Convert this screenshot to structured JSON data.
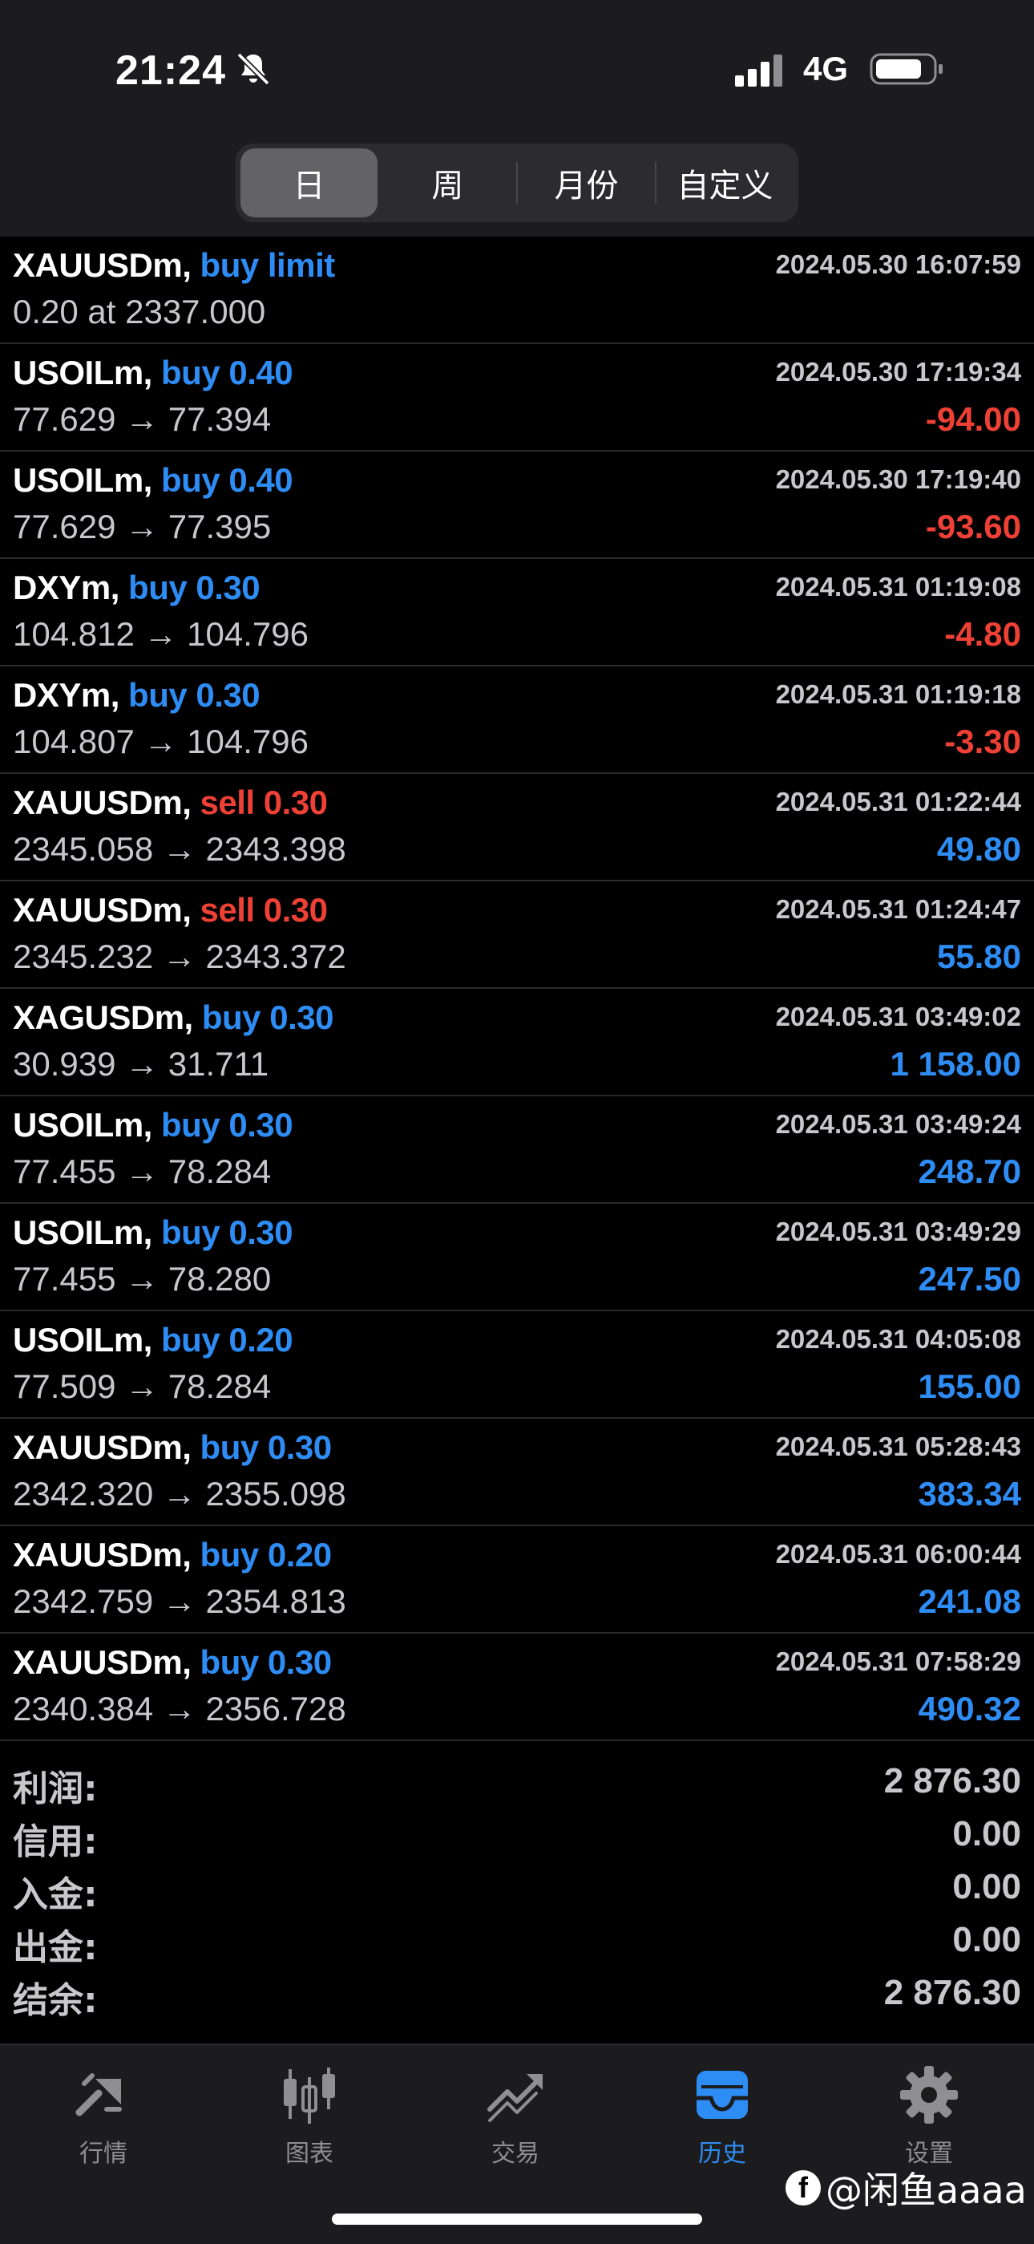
{
  "status_bar": {
    "time": "21:24",
    "network": "4G"
  },
  "period_tabs": [
    {
      "label": "日",
      "active": true
    },
    {
      "label": "周",
      "active": false
    },
    {
      "label": "月份",
      "active": false
    },
    {
      "label": "自定义",
      "active": false
    }
  ],
  "orders": [
    {
      "symbol": "XAUUSDm,",
      "side": "buy",
      "side_label": "buy limit",
      "date": "2024.05.30 16:07:59",
      "prices": "0.20 at 2337.000",
      "profit": "",
      "profit_type": "none"
    },
    {
      "symbol": "USOILm,",
      "side": "buy",
      "side_label": "buy 0.40",
      "date": "2024.05.30 17:19:34",
      "prices": "77.629 → 77.394",
      "profit": "-94.00",
      "profit_type": "neg"
    },
    {
      "symbol": "USOILm,",
      "side": "buy",
      "side_label": "buy 0.40",
      "date": "2024.05.30 17:19:40",
      "prices": "77.629 → 77.395",
      "profit": "-93.60",
      "profit_type": "neg"
    },
    {
      "symbol": "DXYm,",
      "side": "buy",
      "side_label": "buy 0.30",
      "date": "2024.05.31 01:19:08",
      "prices": "104.812 → 104.796",
      "profit": "-4.80",
      "profit_type": "neg"
    },
    {
      "symbol": "DXYm,",
      "side": "buy",
      "side_label": "buy 0.30",
      "date": "2024.05.31 01:19:18",
      "prices": "104.807 → 104.796",
      "profit": "-3.30",
      "profit_type": "neg"
    },
    {
      "symbol": "XAUUSDm,",
      "side": "sell",
      "side_label": "sell 0.30",
      "date": "2024.05.31 01:22:44",
      "prices": "2345.058 → 2343.398",
      "profit": "49.80",
      "profit_type": "pos"
    },
    {
      "symbol": "XAUUSDm,",
      "side": "sell",
      "side_label": "sell 0.30",
      "date": "2024.05.31 01:24:47",
      "prices": "2345.232 → 2343.372",
      "profit": "55.80",
      "profit_type": "pos"
    },
    {
      "symbol": "XAGUSDm,",
      "side": "buy",
      "side_label": "buy 0.30",
      "date": "2024.05.31 03:49:02",
      "prices": "30.939 → 31.711",
      "profit": "1 158.00",
      "profit_type": "pos"
    },
    {
      "symbol": "USOILm,",
      "side": "buy",
      "side_label": "buy 0.30",
      "date": "2024.05.31 03:49:24",
      "prices": "77.455 → 78.284",
      "profit": "248.70",
      "profit_type": "pos"
    },
    {
      "symbol": "USOILm,",
      "side": "buy",
      "side_label": "buy 0.30",
      "date": "2024.05.31 03:49:29",
      "prices": "77.455 → 78.280",
      "profit": "247.50",
      "profit_type": "pos"
    },
    {
      "symbol": "USOILm,",
      "side": "buy",
      "side_label": "buy 0.20",
      "date": "2024.05.31 04:05:08",
      "prices": "77.509 → 78.284",
      "profit": "155.00",
      "profit_type": "pos"
    },
    {
      "symbol": "XAUUSDm,",
      "side": "buy",
      "side_label": "buy 0.30",
      "date": "2024.05.31 05:28:43",
      "prices": "2342.320 → 2355.098",
      "profit": "383.34",
      "profit_type": "pos"
    },
    {
      "symbol": "XAUUSDm,",
      "side": "buy",
      "side_label": "buy 0.20",
      "date": "2024.05.31 06:00:44",
      "prices": "2342.759 → 2354.813",
      "profit": "241.08",
      "profit_type": "pos"
    },
    {
      "symbol": "XAUUSDm,",
      "side": "buy",
      "side_label": "buy 0.30",
      "date": "2024.05.31 07:58:29",
      "prices": "2340.384 → 2356.728",
      "profit": "490.32",
      "profit_type": "pos"
    }
  ],
  "summary": [
    {
      "label": "利润:",
      "value": "2 876.30"
    },
    {
      "label": "信用:",
      "value": "0.00"
    },
    {
      "label": "入金:",
      "value": "0.00"
    },
    {
      "label": "出金:",
      "value": "0.00"
    },
    {
      "label": "结余:",
      "value": "2 876.30"
    }
  ],
  "tab_bar": [
    {
      "label": "行情",
      "icon": "quotes-icon",
      "active": false
    },
    {
      "label": "图表",
      "icon": "chart-icon",
      "active": false
    },
    {
      "label": "交易",
      "icon": "trade-icon",
      "active": false
    },
    {
      "label": "历史",
      "icon": "history-icon",
      "active": true
    },
    {
      "label": "设置",
      "icon": "settings-icon",
      "active": false
    }
  ],
  "watermark": {
    "logo": "f",
    "text": "@闲鱼aaaa"
  },
  "colors": {
    "buy": "#2e8df5",
    "sell": "#ef4036",
    "active_tab": "#2e8df5",
    "header_bg": "#1c1c1e"
  }
}
